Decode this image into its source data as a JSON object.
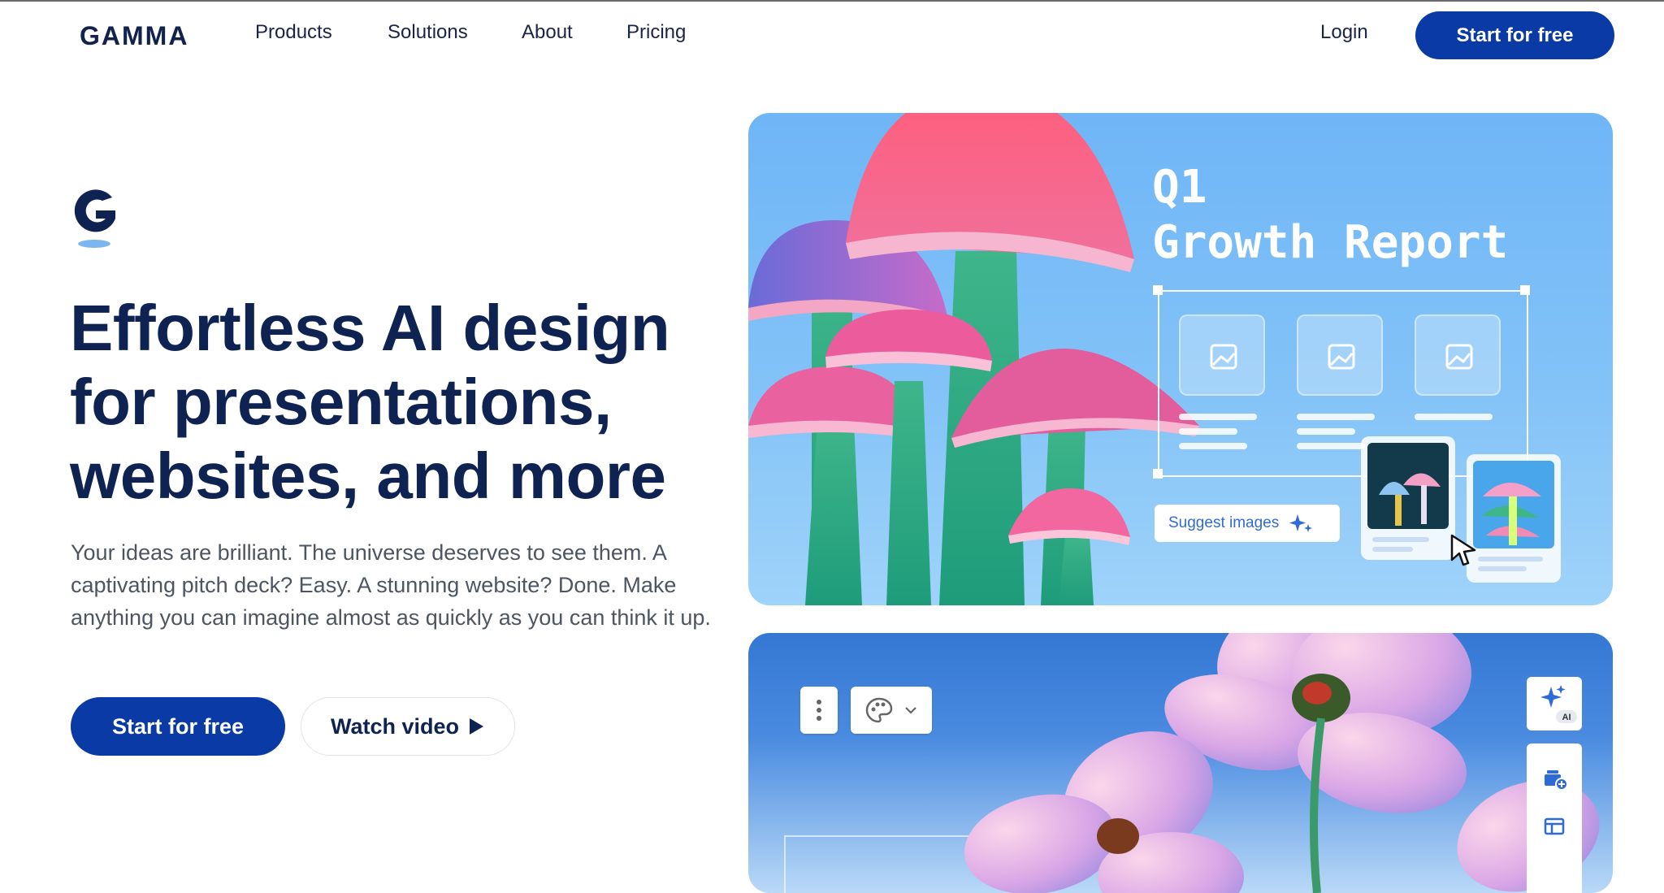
{
  "nav": {
    "logo": "GAMMA",
    "items": [
      "Products",
      "Solutions",
      "About",
      "Pricing"
    ],
    "login": "Login",
    "cta": "Start for free"
  },
  "hero": {
    "title": "Effortless AI design for presentations, websites, and more",
    "subtitle": "Your ideas are brilliant. The universe deserves to see them. A captivating pitch deck? Easy. A stunning website? Done. Make anything you can imagine almost as quickly as you can think it up.",
    "primary_cta": "Start for free",
    "secondary_cta": "Watch video"
  },
  "card1": {
    "title_line1": "Q1",
    "title_line2": "Growth Report",
    "suggest_label": "Suggest images"
  },
  "card2": {
    "ai_badge": "AI"
  },
  "colors": {
    "brand_blue": "#0a3aa5",
    "heading_navy": "#0f2352",
    "card_sky": "#7ebff7",
    "card_deep": "#3478d4"
  },
  "icons": [
    "play-icon",
    "image-placeholder-icon",
    "sparkle-icon",
    "cursor-icon",
    "more-vert-icon",
    "palette-icon",
    "chevron-down-icon",
    "ai-sparkle-icon",
    "add-card-icon",
    "layout-icon"
  ]
}
